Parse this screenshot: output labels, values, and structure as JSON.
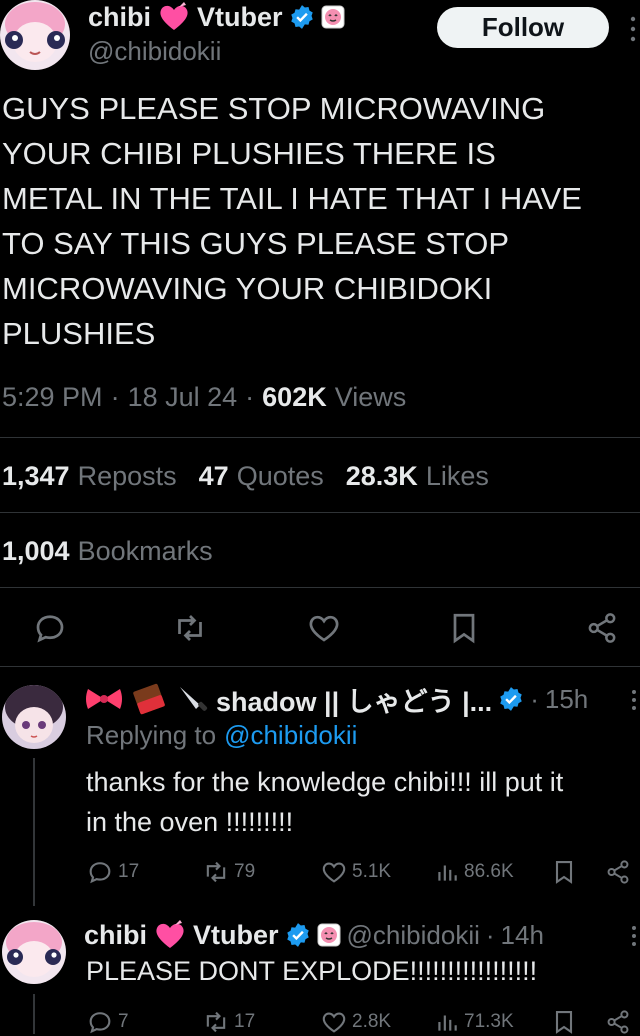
{
  "main_tweet": {
    "display_name_left": "chibi",
    "display_name_right": "Vtuber",
    "handle": "@chibidokii",
    "follow_label": "Follow",
    "text_lines": [
      "GUYS PLEASE STOP MICROWAVING",
      "YOUR CHIBI PLUSHIES THERE IS",
      "METAL IN THE TAIL I HATE THAT I HAVE",
      "TO SAY THIS GUYS PLEASE STOP",
      "MICROWAVING YOUR CHIBIDOKI",
      "PLUSHIES"
    ],
    "time": "5:29 PM",
    "date": "18 Jul 24",
    "views_count": "602K",
    "views_label": "Views",
    "reposts_count": "1,347",
    "reposts_label": "Reposts",
    "quotes_count": "47",
    "quotes_label": "Quotes",
    "likes_count": "28.3K",
    "likes_label": "Likes",
    "bookmarks_count": "1,004",
    "bookmarks_label": "Bookmarks"
  },
  "reply1": {
    "display_name": "shadow || しゃどう |...",
    "time": "15h",
    "replying_prefix": "Replying to",
    "replying_handle": "@chibidokii",
    "text_lines": [
      "thanks for the knowledge chibi!!! ill put it",
      "in the oven !!!!!!!!!"
    ],
    "replies": "17",
    "reposts": "79",
    "likes": "5.1K",
    "views": "86.6K"
  },
  "reply2": {
    "display_name_left": "chibi",
    "display_name_right": "Vtuber",
    "handle": "@chibidokii",
    "time": "14h",
    "text": "PLEASE DONT EXPLODE!!!!!!!!!!!!!!!!!",
    "replies": "7",
    "reposts": "17",
    "likes": "2.8K",
    "views": "71.3K"
  },
  "colors": {
    "background": "#000000",
    "text": "#e7e9ea",
    "muted": "#71767b",
    "link": "#1d9bf0",
    "divider": "#2f3336",
    "verified": "#1d9bf0",
    "heart_emoji": "#ff4fa3"
  },
  "separator": "·"
}
